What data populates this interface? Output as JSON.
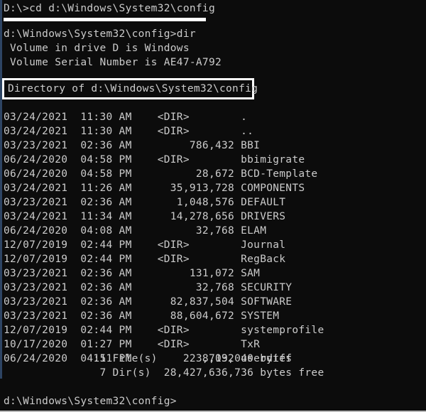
{
  "terminal": {
    "background_color": "#0c0c0c",
    "text_color": "#cccccc",
    "highlight_color": "#ffffff",
    "left_strip_color": "#2d4463"
  },
  "header": {
    "command_line": "D:\\>cd d:\\Windows\\System32\\config"
  },
  "volume": {
    "dir_command": "d:\\Windows\\System32\\config>dir",
    "volume_in_drive": " Volume in drive D is Windows",
    "volume_serial": " Volume Serial Number is AE47-A792"
  },
  "directory_of": {
    "text": "Directory of d:\\Windows\\System32\\config"
  },
  "listing": {
    "columns": [
      "date",
      "time",
      "size",
      "name"
    ],
    "rows": [
      {
        "date": "03/24/2021",
        "time": "11:30 AM",
        "size": "<DIR>",
        "name": "."
      },
      {
        "date": "03/24/2021",
        "time": "11:30 AM",
        "size": "<DIR>",
        "name": ".."
      },
      {
        "date": "03/23/2021",
        "time": "02:36 AM",
        "size": "786,432",
        "name": "BBI"
      },
      {
        "date": "06/24/2020",
        "time": "04:58 PM",
        "size": "<DIR>",
        "name": "bbimigrate"
      },
      {
        "date": "06/24/2020",
        "time": "04:58 PM",
        "size": "28,672",
        "name": "BCD-Template"
      },
      {
        "date": "03/24/2021",
        "time": "11:26 AM",
        "size": "35,913,728",
        "name": "COMPONENTS"
      },
      {
        "date": "03/23/2021",
        "time": "02:36 AM",
        "size": "1,048,576",
        "name": "DEFAULT"
      },
      {
        "date": "03/24/2021",
        "time": "11:34 AM",
        "size": "14,278,656",
        "name": "DRIVERS"
      },
      {
        "date": "06/24/2020",
        "time": "04:08 AM",
        "size": "32,768",
        "name": "ELAM"
      },
      {
        "date": "12/07/2019",
        "time": "02:44 PM",
        "size": "<DIR>",
        "name": "Journal"
      },
      {
        "date": "12/07/2019",
        "time": "02:44 PM",
        "size": "<DIR>",
        "name": "RegBack"
      },
      {
        "date": "03/23/2021",
        "time": "02:36 AM",
        "size": "131,072",
        "name": "SAM"
      },
      {
        "date": "03/23/2021",
        "time": "02:36 AM",
        "size": "32,768",
        "name": "SECURITY"
      },
      {
        "date": "03/23/2021",
        "time": "02:36 AM",
        "size": "82,837,504",
        "name": "SOFTWARE"
      },
      {
        "date": "03/23/2021",
        "time": "02:36 AM",
        "size": "88,604,672",
        "name": "SYSTEM"
      },
      {
        "date": "12/07/2019",
        "time": "02:44 PM",
        "size": "<DIR>",
        "name": "systemprofile"
      },
      {
        "date": "10/17/2020",
        "time": "01:27 PM",
        "size": "<DIR>",
        "name": "TxR"
      },
      {
        "date": "06/24/2020",
        "time": "04:51 PM",
        "size": "8,192",
        "name": "userdiff"
      }
    ]
  },
  "summary": {
    "file_count": "11",
    "files_label": "File(s)",
    "total_bytes": "223,703,040",
    "bytes_label": "bytes",
    "dir_count": "7",
    "dirs_label": "Dir(s)",
    "free_bytes": "28,427,636,736",
    "free_label": "bytes free",
    "files_line": "              11 File(s)    223,703,040 bytes",
    "dirs_line": "               7 Dir(s)  28,427,636,736 bytes free"
  },
  "footer": {
    "prompt": "d:\\Windows\\System32\\config>"
  }
}
